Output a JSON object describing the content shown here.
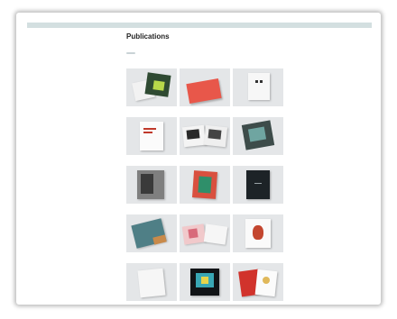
{
  "page": {
    "header_text": "",
    "title": "Publications",
    "intro": "",
    "filter_label": ""
  },
  "publications": [
    {
      "title": "",
      "icon": "photo-book-cover-icon"
    },
    {
      "title": "",
      "icon": "red-book-icon"
    },
    {
      "title": "",
      "icon": "white-box-icon"
    },
    {
      "title": "",
      "icon": "white-book-icon"
    },
    {
      "title": "",
      "icon": "open-book-icon"
    },
    {
      "title": "",
      "icon": "dark-book-cover-icon"
    },
    {
      "title": "",
      "icon": "photo-book-cover-icon"
    },
    {
      "title": "",
      "icon": "red-book-icon"
    },
    {
      "title": "",
      "icon": "dark-book-icon"
    },
    {
      "title": "",
      "icon": "teal-book-icon"
    },
    {
      "title": "",
      "icon": "open-book-icon"
    },
    {
      "title": "",
      "icon": "white-book-icon"
    },
    {
      "title": "",
      "icon": "white-book-icon"
    },
    {
      "title": "",
      "icon": "dark-book-cover-icon"
    },
    {
      "title": "",
      "icon": "red-book-icon"
    }
  ]
}
